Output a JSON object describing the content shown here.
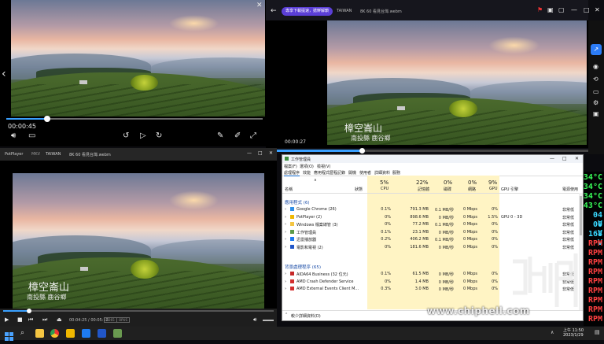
{
  "player_top_left": {
    "time": "00:00:45",
    "progress": 0.16
  },
  "player_right": {
    "banner_label": "専享下載提速，搶鮮解鎖",
    "channel": "TAIWAN",
    "title": "8K 60 看見台灣.webm",
    "time": "00:00:27",
    "progress": 0.3,
    "caption_main": "樟空崙山",
    "caption_sub": "南投縣 鹿谷鄉"
  },
  "player_bottom": {
    "app_name": "PotPlayer",
    "format": "MKV",
    "channel": "TAIWAN",
    "title": "8K 60 看見台灣.webm",
    "caption_main": "樟空崙山",
    "caption_sub": "南投縣 鹿谷鄉",
    "time": "00:04:25 / 00:05:12",
    "badges": [
      "H265",
      "OPUS"
    ],
    "progress": 0.1
  },
  "task_manager": {
    "title": "工作管理員",
    "menu": [
      "檔案(F)",
      "選項(O)",
      "檢視(V)"
    ],
    "tabs": [
      "處理程序",
      "效能",
      "應用程式歷程記錄",
      "開機",
      "使用者",
      "詳細資料",
      "服務"
    ],
    "columns": [
      {
        "name": "名稱",
        "pct": ""
      },
      {
        "name": "狀態",
        "pct": ""
      },
      {
        "name": "CPU",
        "pct": "5%"
      },
      {
        "name": "記憶體",
        "pct": "22%"
      },
      {
        "name": "磁碟",
        "pct": "0%"
      },
      {
        "name": "網路",
        "pct": "0%"
      },
      {
        "name": "GPU",
        "pct": "9%"
      },
      {
        "name": "GPU 引擎",
        "pct": ""
      },
      {
        "name": "電源使用",
        "pct": ""
      }
    ],
    "group_apps": "應用程式 (6)",
    "apps": [
      {
        "name": "Google Chrome (26)",
        "cpu": "0.1%",
        "mem": "791.3 MB",
        "disk": "0.1 MB/秒",
        "net": "0 Mbps",
        "gpu": "0%",
        "engine": "",
        "power": "非常低"
      },
      {
        "name": "PotPlayer (2)",
        "cpu": "0%",
        "mem": "898.6 MB",
        "disk": "0 MB/秒",
        "net": "0 Mbps",
        "gpu": "1.5%",
        "engine": "GPU 0 - 3D",
        "power": "非常低"
      },
      {
        "name": "Windows 檔案總管 (3)",
        "cpu": "0%",
        "mem": "77.2 MB",
        "disk": "0.1 MB/秒",
        "net": "0 Mbps",
        "gpu": "0%",
        "engine": "",
        "power": "非常低"
      },
      {
        "name": "工作管理員",
        "cpu": "0.1%",
        "mem": "23.1 MB",
        "disk": "0 MB/秒",
        "net": "0 Mbps",
        "gpu": "0%",
        "engine": "",
        "power": "非常低"
      },
      {
        "name": "迅雷播放器",
        "cpu": "0.2%",
        "mem": "406.2 MB",
        "disk": "0.1 MB/秒",
        "net": "0 Mbps",
        "gpu": "0%",
        "engine": "",
        "power": "非常低"
      },
      {
        "name": "電影和電視 (2)",
        "cpu": "0%",
        "mem": "181.6 MB",
        "disk": "0 MB/秒",
        "net": "0 Mbps",
        "gpu": "0%",
        "engine": "",
        "power": "非常低"
      }
    ],
    "group_bg": "背景處理程序 (65)",
    "bg": [
      {
        "name": "AIDA64 Business (32 位元)",
        "cpu": "0.1%",
        "mem": "61.5 MB",
        "disk": "0 MB/秒",
        "net": "0 Mbps",
        "gpu": "0%",
        "engine": "",
        "power": "非常低"
      },
      {
        "name": "AMD Crash Defender Service",
        "cpu": "0%",
        "mem": "1.4 MB",
        "disk": "0 MB/秒",
        "net": "0 Mbps",
        "gpu": "0%",
        "engine": "",
        "power": "非常低"
      },
      {
        "name": "AMD External Events Client M...",
        "cpu": "0.3%",
        "mem": "3.0 MB",
        "disk": "0 MB/秒",
        "net": "0 Mbps",
        "gpu": "0%",
        "engine": "",
        "power": "非常低"
      }
    ],
    "fewer_details": "較少詳細資料(D)"
  },
  "watermark": "www.chiphell.com",
  "monitor": [
    {
      "text": "34°C",
      "color": "#39ff5a"
    },
    {
      "text": "34°C",
      "color": "#39ff5a"
    },
    {
      "text": "34°C",
      "color": "#39ff5a"
    },
    {
      "text": "43°C",
      "color": "#39ff5a"
    },
    {
      "text": "04 V",
      "color": "#39d9ff"
    },
    {
      "text": "00 V",
      "color": "#39d9ff"
    },
    {
      "text": "168 V",
      "color": "#39d9ff"
    },
    {
      "text": "RPM",
      "color": "#ff4040"
    },
    {
      "text": "RPM",
      "color": "#ff4040"
    },
    {
      "text": "RPM",
      "color": "#ff4040"
    },
    {
      "text": "RPM",
      "color": "#ff4040"
    },
    {
      "text": "RPM",
      "color": "#ff4040"
    },
    {
      "text": "RPM",
      "color": "#ff4040"
    },
    {
      "text": "RPM",
      "color": "#ff4040"
    },
    {
      "text": "RPM",
      "color": "#ff4040"
    },
    {
      "text": "RPM",
      "color": "#ff4040"
    }
  ],
  "clock": {
    "time": "上午 11:50",
    "date": "2023/1/29"
  }
}
